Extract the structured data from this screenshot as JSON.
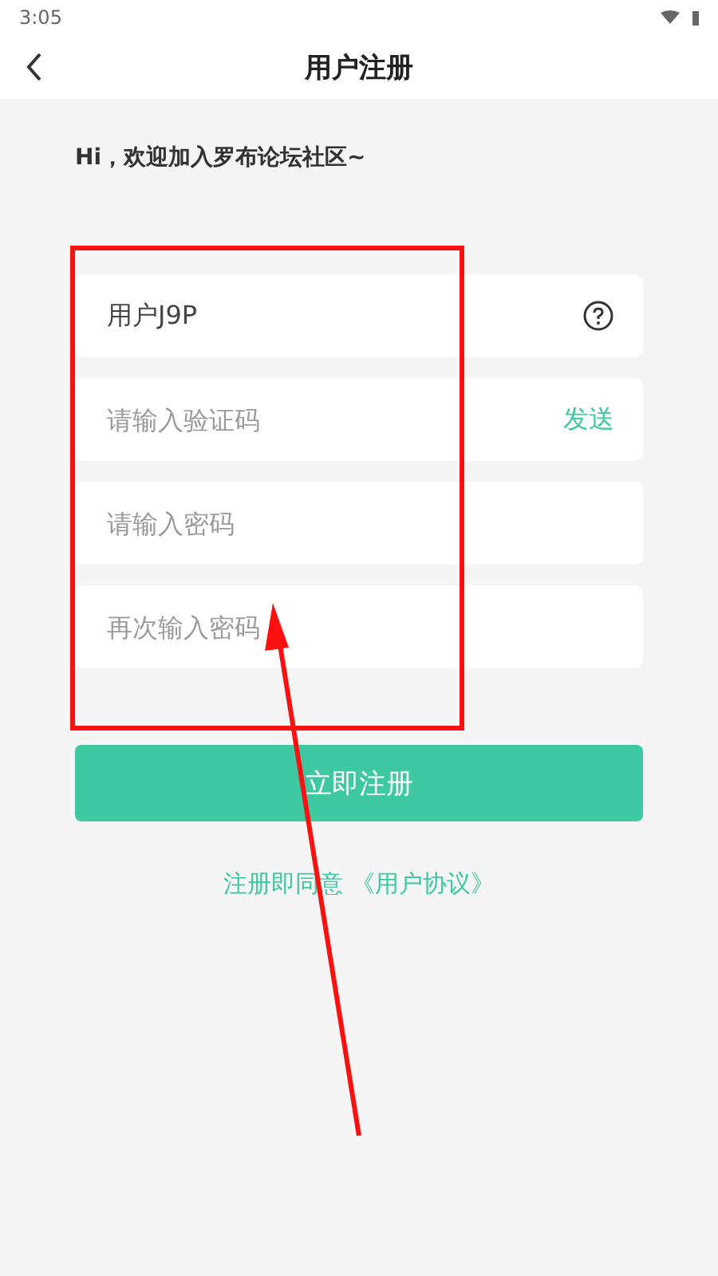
{
  "status_bar": {
    "time": "3:05"
  },
  "header": {
    "title": "用户注册"
  },
  "greeting": "Hi，欢迎加入罗布论坛社区~",
  "fields": [
    {
      "kind": "help",
      "value": "用户J9P"
    },
    {
      "kind": "action",
      "placeholder": "请输入验证码",
      "action": "发送"
    },
    {
      "kind": "plain",
      "placeholder": "请输入密码"
    },
    {
      "kind": "plain",
      "placeholder": "再次输入密码"
    }
  ],
  "submit": "立即注册",
  "agreement": "注册即同意 《用户协议》"
}
